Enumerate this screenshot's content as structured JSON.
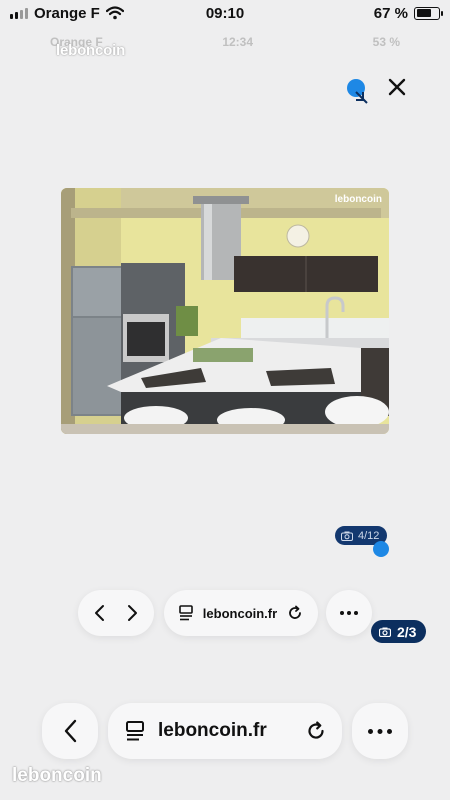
{
  "status_bar": {
    "carrier": "Orange F",
    "time": "09:10",
    "battery_text": "67 %",
    "battery_level": 0.67
  },
  "ghost_status": {
    "carrier": "Orange F",
    "time": "12:34",
    "battery_text": "53 %"
  },
  "watermark": "leboncoin",
  "photo": {
    "watermark": "leboncoin",
    "counter_small": "4/12",
    "counter_large": "2/3"
  },
  "inner_toolbar": {
    "url": "leboncoin.fr"
  },
  "outer_toolbar": {
    "url": "leboncoin.fr"
  },
  "icons": {
    "close": "close-icon",
    "back": "chevron-left-icon",
    "forward": "chevron-right-icon",
    "reader": "reader-mode-icon",
    "reload": "reload-icon",
    "more": "more-icon",
    "camera": "camera-icon",
    "wifi": "wifi-icon",
    "signal": "signal-icon",
    "battery": "battery-icon"
  },
  "colors": {
    "background": "#eeeeef",
    "badge_navy": "#0c2f5f",
    "touch_blue": "#1e88e5"
  }
}
